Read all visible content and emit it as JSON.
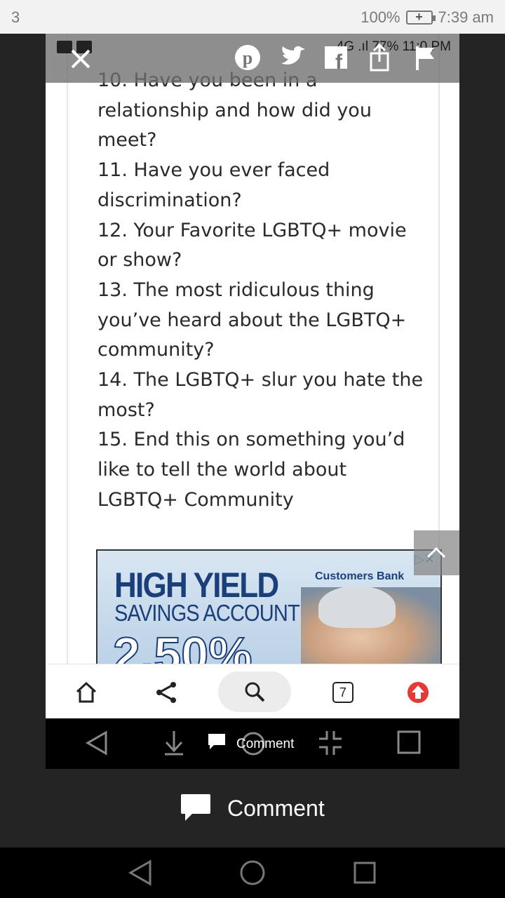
{
  "status_bar": {
    "notification_count": "3",
    "battery": "100%",
    "battery_glyph": "+",
    "time": "7:39 am"
  },
  "embedded": {
    "status": {
      "network": "4G",
      "battery": "77%",
      "time": "11:0 PM"
    },
    "overlay_icons": [
      "close-icon",
      "pinterest-icon",
      "twitter-icon",
      "facebook-icon",
      "share-icon",
      "flag-icon"
    ],
    "article": {
      "questions": [
        "10. Have you been in a relationship and how did you meet?",
        "11. Have you ever faced discrimination?",
        "12. Your Favorite LGBTQ+ movie or show?",
        "13. The most ridiculous thing you’ve heard about the LGBTQ+ community?",
        "14. The LGBTQ+ slur you hate the most?",
        "15. End this on something you’d like to tell the world about LGBTQ+ Community"
      ]
    },
    "ad": {
      "headline": "HIGH YIELD",
      "subheadline": "SAVINGS ACCOUNT",
      "rate": "2.50%",
      "brand": "Customers Bank"
    },
    "toolbar": {
      "tabs_count": "7",
      "items": [
        "home-icon",
        "share-icon",
        "search-icon",
        "tabs-icon",
        "upload-icon"
      ]
    },
    "nav": {
      "comment_label": "Comment"
    }
  },
  "comment_bar": {
    "label": "Comment"
  },
  "colors": {
    "background": "#242424",
    "accent_red": "#e53935",
    "ad_blue": "#1b3f7a"
  }
}
